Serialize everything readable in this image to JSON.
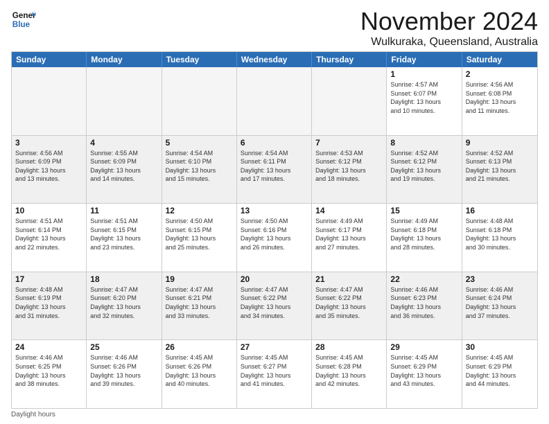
{
  "logo": {
    "line1": "General",
    "line2": "Blue"
  },
  "title": "November 2024",
  "location": "Wulkuraka, Queensland, Australia",
  "footer": "Daylight hours",
  "headers": [
    "Sunday",
    "Monday",
    "Tuesday",
    "Wednesday",
    "Thursday",
    "Friday",
    "Saturday"
  ],
  "rows": [
    [
      {
        "day": "",
        "info": "",
        "empty": true
      },
      {
        "day": "",
        "info": "",
        "empty": true
      },
      {
        "day": "",
        "info": "",
        "empty": true
      },
      {
        "day": "",
        "info": "",
        "empty": true
      },
      {
        "day": "",
        "info": "",
        "empty": true
      },
      {
        "day": "1",
        "info": "Sunrise: 4:57 AM\nSunset: 6:07 PM\nDaylight: 13 hours\nand 10 minutes."
      },
      {
        "day": "2",
        "info": "Sunrise: 4:56 AM\nSunset: 6:08 PM\nDaylight: 13 hours\nand 11 minutes."
      }
    ],
    [
      {
        "day": "3",
        "info": "Sunrise: 4:56 AM\nSunset: 6:09 PM\nDaylight: 13 hours\nand 13 minutes."
      },
      {
        "day": "4",
        "info": "Sunrise: 4:55 AM\nSunset: 6:09 PM\nDaylight: 13 hours\nand 14 minutes."
      },
      {
        "day": "5",
        "info": "Sunrise: 4:54 AM\nSunset: 6:10 PM\nDaylight: 13 hours\nand 15 minutes."
      },
      {
        "day": "6",
        "info": "Sunrise: 4:54 AM\nSunset: 6:11 PM\nDaylight: 13 hours\nand 17 minutes."
      },
      {
        "day": "7",
        "info": "Sunrise: 4:53 AM\nSunset: 6:12 PM\nDaylight: 13 hours\nand 18 minutes."
      },
      {
        "day": "8",
        "info": "Sunrise: 4:52 AM\nSunset: 6:12 PM\nDaylight: 13 hours\nand 19 minutes."
      },
      {
        "day": "9",
        "info": "Sunrise: 4:52 AM\nSunset: 6:13 PM\nDaylight: 13 hours\nand 21 minutes."
      }
    ],
    [
      {
        "day": "10",
        "info": "Sunrise: 4:51 AM\nSunset: 6:14 PM\nDaylight: 13 hours\nand 22 minutes."
      },
      {
        "day": "11",
        "info": "Sunrise: 4:51 AM\nSunset: 6:15 PM\nDaylight: 13 hours\nand 23 minutes."
      },
      {
        "day": "12",
        "info": "Sunrise: 4:50 AM\nSunset: 6:15 PM\nDaylight: 13 hours\nand 25 minutes."
      },
      {
        "day": "13",
        "info": "Sunrise: 4:50 AM\nSunset: 6:16 PM\nDaylight: 13 hours\nand 26 minutes."
      },
      {
        "day": "14",
        "info": "Sunrise: 4:49 AM\nSunset: 6:17 PM\nDaylight: 13 hours\nand 27 minutes."
      },
      {
        "day": "15",
        "info": "Sunrise: 4:49 AM\nSunset: 6:18 PM\nDaylight: 13 hours\nand 28 minutes."
      },
      {
        "day": "16",
        "info": "Sunrise: 4:48 AM\nSunset: 6:18 PM\nDaylight: 13 hours\nand 30 minutes."
      }
    ],
    [
      {
        "day": "17",
        "info": "Sunrise: 4:48 AM\nSunset: 6:19 PM\nDaylight: 13 hours\nand 31 minutes."
      },
      {
        "day": "18",
        "info": "Sunrise: 4:47 AM\nSunset: 6:20 PM\nDaylight: 13 hours\nand 32 minutes."
      },
      {
        "day": "19",
        "info": "Sunrise: 4:47 AM\nSunset: 6:21 PM\nDaylight: 13 hours\nand 33 minutes."
      },
      {
        "day": "20",
        "info": "Sunrise: 4:47 AM\nSunset: 6:22 PM\nDaylight: 13 hours\nand 34 minutes."
      },
      {
        "day": "21",
        "info": "Sunrise: 4:47 AM\nSunset: 6:22 PM\nDaylight: 13 hours\nand 35 minutes."
      },
      {
        "day": "22",
        "info": "Sunrise: 4:46 AM\nSunset: 6:23 PM\nDaylight: 13 hours\nand 36 minutes."
      },
      {
        "day": "23",
        "info": "Sunrise: 4:46 AM\nSunset: 6:24 PM\nDaylight: 13 hours\nand 37 minutes."
      }
    ],
    [
      {
        "day": "24",
        "info": "Sunrise: 4:46 AM\nSunset: 6:25 PM\nDaylight: 13 hours\nand 38 minutes."
      },
      {
        "day": "25",
        "info": "Sunrise: 4:46 AM\nSunset: 6:26 PM\nDaylight: 13 hours\nand 39 minutes."
      },
      {
        "day": "26",
        "info": "Sunrise: 4:45 AM\nSunset: 6:26 PM\nDaylight: 13 hours\nand 40 minutes."
      },
      {
        "day": "27",
        "info": "Sunrise: 4:45 AM\nSunset: 6:27 PM\nDaylight: 13 hours\nand 41 minutes."
      },
      {
        "day": "28",
        "info": "Sunrise: 4:45 AM\nSunset: 6:28 PM\nDaylight: 13 hours\nand 42 minutes."
      },
      {
        "day": "29",
        "info": "Sunrise: 4:45 AM\nSunset: 6:29 PM\nDaylight: 13 hours\nand 43 minutes."
      },
      {
        "day": "30",
        "info": "Sunrise: 4:45 AM\nSunset: 6:29 PM\nDaylight: 13 hours\nand 44 minutes."
      }
    ]
  ]
}
